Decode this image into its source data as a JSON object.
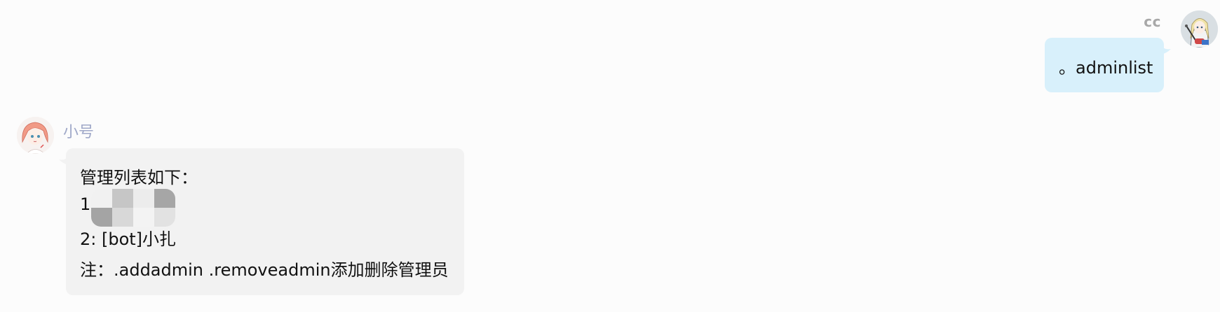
{
  "outgoing": {
    "sender_name": "cc",
    "message_text": "。adminlist",
    "bubble_color": "#d8f0fb"
  },
  "incoming": {
    "sender_name": "小号",
    "lines": [
      "管理列表如下：",
      "1",
      "2: [bot]小扎",
      "注：.addadmin .removeadmin添加删除管理员"
    ],
    "bubble_color": "#f2f2f2",
    "redacted_content": "mosaic-blur"
  },
  "avatars": {
    "right": "anime-girl-guitar-avatar",
    "left": "anime-girl-pink-hair-avatar"
  }
}
